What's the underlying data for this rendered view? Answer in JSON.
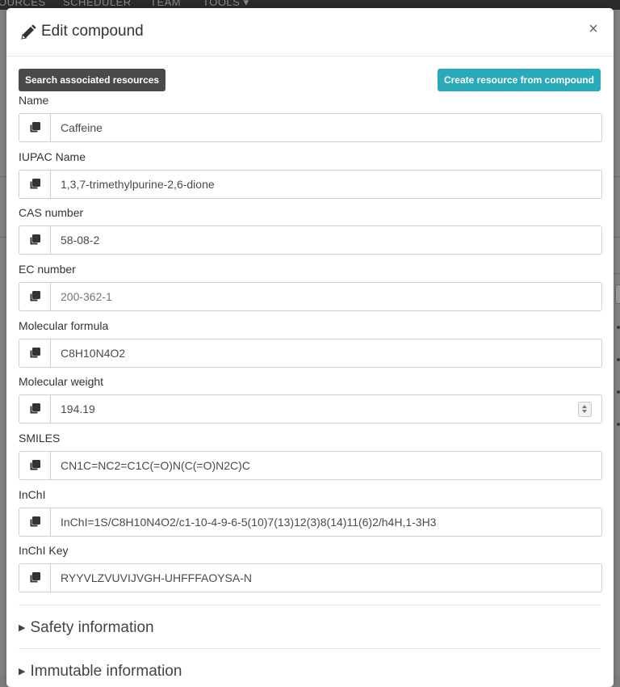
{
  "background_nav": [
    "OURCES",
    "SCHEDULER",
    "TEAM",
    "TOOLS ▾"
  ],
  "modal": {
    "title": "Edit compound",
    "close_label": "×"
  },
  "actions": {
    "search_label": "Search associated resources",
    "create_label": "Create resource from compound"
  },
  "fields": [
    {
      "label": "Name",
      "value": "Caffeine"
    },
    {
      "label": "IUPAC Name",
      "value": "1,3,7-trimethylpurine-2,6-dione"
    },
    {
      "label": "CAS number",
      "value": "58-08-2"
    },
    {
      "label": "EC number",
      "value": "",
      "placeholder": "200-362-1"
    },
    {
      "label": "Molecular formula",
      "value": "C8H10N4O2"
    },
    {
      "label": "Molecular weight",
      "value": "194.19"
    },
    {
      "label": "SMILES",
      "value": "CN1C=NC2=C1C(=O)N(C(=O)N2C)C"
    },
    {
      "label": "InChI",
      "value": "InChI=1S/C8H10N4O2/c1-10-4-9-6-5(10)7(13)12(3)8(14)11(6)2/h4H,1-3H3"
    },
    {
      "label": "InChI Key",
      "value": "RYYVLZVUVIJVGH-UHFFFAOYSA-N"
    }
  ],
  "sections": [
    {
      "label": "Safety information",
      "expanded": false
    },
    {
      "label": "Immutable information",
      "expanded": false
    }
  ],
  "colors": {
    "primary_dark": "#4a4a4a",
    "accent_teal": "#2aa9b8"
  },
  "icons": {
    "title_icon": "pencil-icon",
    "copy_icon": "copy-icon"
  }
}
